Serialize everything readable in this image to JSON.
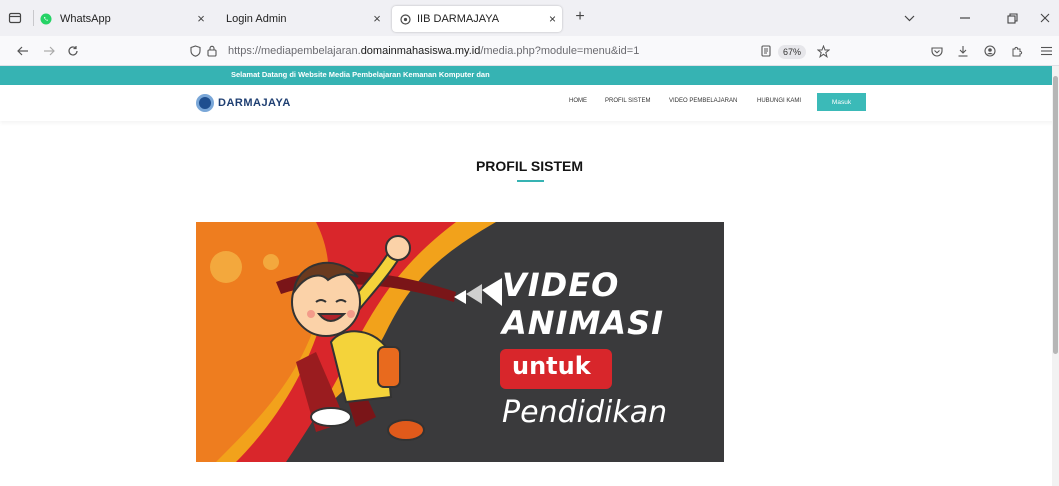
{
  "browser": {
    "tabs": [
      {
        "label": "WhatsApp",
        "close": "×"
      },
      {
        "label": "Login Admin",
        "close": "×"
      },
      {
        "label": "IIB DARMAJAYA",
        "close": "×"
      }
    ],
    "new_tab": "+",
    "url_prefix": "https://mediapembelajaran.",
    "url_host": "domainmahasiswa.my.id",
    "url_path": "/media.php?module=menu&id=1",
    "zoom": "67%"
  },
  "site": {
    "welcome": "Selamat Datang di Website Media Pembelajaran Kemanan Komputer dan",
    "logo_text": "DARMAJAYA",
    "menu": [
      "HOME",
      "PROFIL SISTEM",
      "VIDEO PEMBELAJARAN",
      "HUBUNGI KAMI"
    ],
    "login_button": "Masuk",
    "section_title": "PROFIL SISTEM",
    "banner": {
      "line1": "VIDEO",
      "line2": "ANIMASI",
      "line3": "untuk",
      "line4": "Pendidikan"
    }
  },
  "colors": {
    "accent": "#36b3b3",
    "banner_bg": "#3a3a3c",
    "banner_red": "#d8262b"
  }
}
